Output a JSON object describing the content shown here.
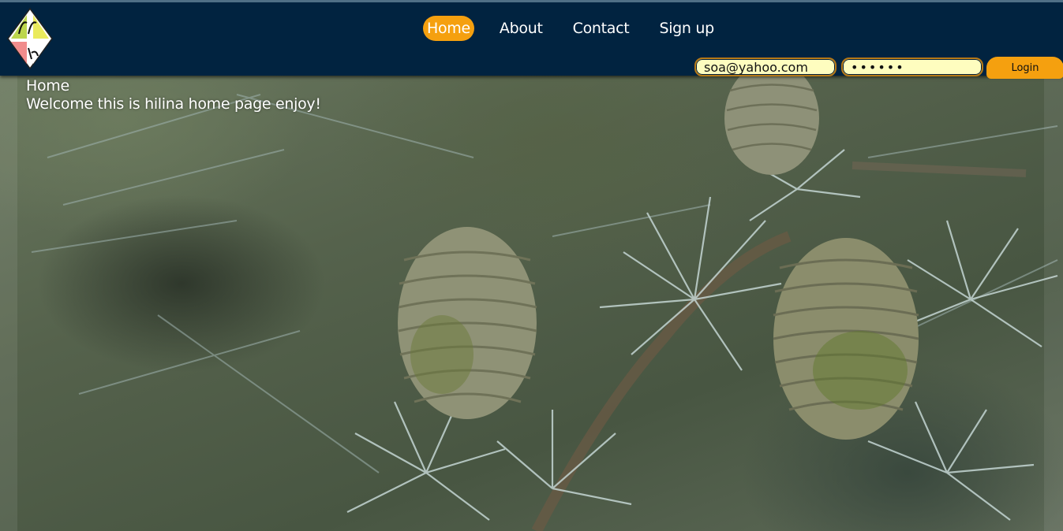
{
  "nav": {
    "items": [
      {
        "label": "Home",
        "active": true
      },
      {
        "label": "About",
        "active": false
      },
      {
        "label": "Contact",
        "active": false
      },
      {
        "label": "Sign up",
        "active": false
      }
    ]
  },
  "login": {
    "email_value": "soa@yahoo.com",
    "password_value": "••••••",
    "button_label": "Login"
  },
  "content": {
    "title": "Home",
    "text": "Welcome this is hilina home page enjoy!"
  },
  "colors": {
    "header_bg": "#012340",
    "accent": "#f5a00f",
    "input_bg": "#fefdbf"
  }
}
